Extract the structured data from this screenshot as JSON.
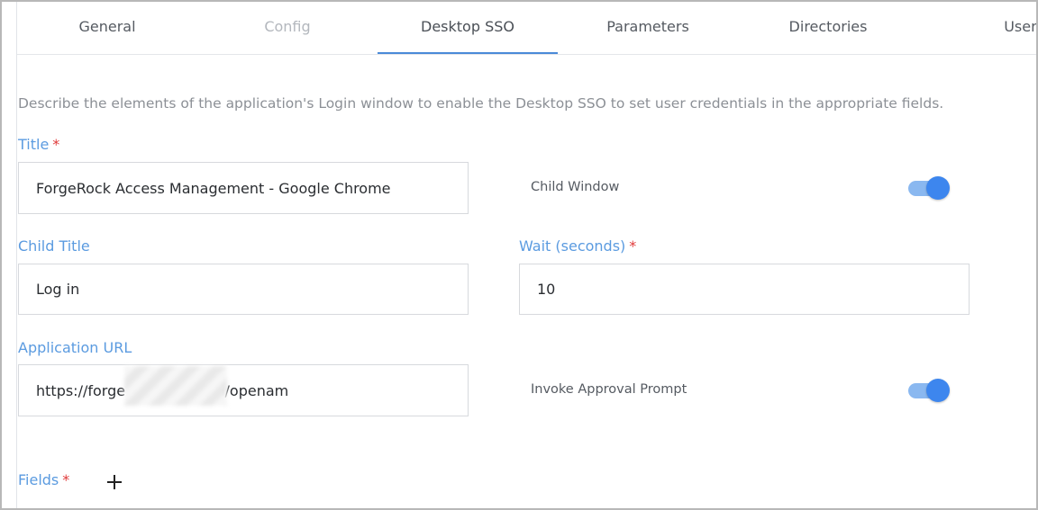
{
  "tabs": [
    {
      "label": "General",
      "state": "normal"
    },
    {
      "label": "Config",
      "state": "disabled"
    },
    {
      "label": "Desktop SSO",
      "state": "active"
    },
    {
      "label": "Parameters",
      "state": "normal"
    },
    {
      "label": "Directories",
      "state": "normal"
    },
    {
      "label": "Users",
      "state": "normal"
    }
  ],
  "description": "Describe the elements of the application's Login window to enable the Desktop SSO to set user credentials in the appropriate fields.",
  "form": {
    "title": {
      "label": "Title",
      "required_mark": "*",
      "value": "ForgeRock Access Management - Google Chrome"
    },
    "child_window": {
      "label": "Child Window",
      "on": true
    },
    "child_title": {
      "label": "Child Title",
      "value": "Log in"
    },
    "wait": {
      "label": "Wait (seconds)",
      "required_mark": "*",
      "value": "10"
    },
    "application_url": {
      "label": "Application URL",
      "value": "https://forge              .com/openam"
    },
    "invoke_approval": {
      "label": "Invoke Approval Prompt",
      "on": true
    },
    "fields": {
      "label": "Fields",
      "required_mark": "*"
    }
  },
  "colors": {
    "accent": "#4a8ad8",
    "label": "#5b9be0",
    "required": "#e03a3a",
    "toggle_on": "#3d86ee"
  },
  "icons": {
    "add_field": "plus-icon"
  }
}
